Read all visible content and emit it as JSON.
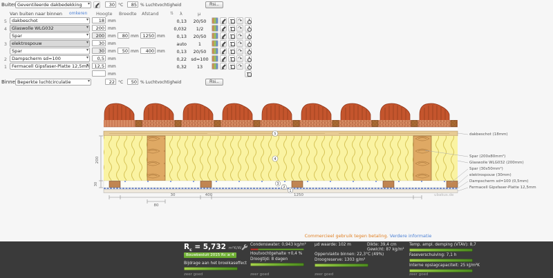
{
  "outside": {
    "label": "Buiten",
    "material": "Geventileerde dakbedekking",
    "temp": "30",
    "temp_unit": "°C",
    "humidity": "85",
    "humidity_label": "% Luchtvochtigheid",
    "rsi": "Rsi..."
  },
  "table": {
    "direction_label": "Van buiten naar binnen",
    "reverse_link": "omkeren",
    "col_hoogte": "Hoogte",
    "col_breedte": "Breedte",
    "col_afstand": "Afstand",
    "col_lambda": "λ",
    "col_mu": "µ",
    "unit_mm": "mm",
    "sort_glyph": "⇅",
    "caret_glyph": "▾",
    "move_glyph": "↷"
  },
  "layers": [
    {
      "num": "5",
      "material": "dakbeschot",
      "hoogte": "18",
      "lambda": "0,13",
      "mu": "20/50"
    },
    {
      "num": "4",
      "material": "Glaswolle WLG032",
      "hoogte": "200",
      "lambda": "0,032",
      "mu": "1/2"
    },
    {
      "num": "",
      "material": "Spar",
      "hoogte": "200",
      "breedte": "80",
      "afstand": "1250",
      "lambda": "0,13",
      "mu": "20/50"
    },
    {
      "num": "3",
      "material": "elektrospouw",
      "hoogte": "30",
      "lambda": "auto",
      "mu": "1"
    },
    {
      "num": "",
      "material": "Spar",
      "hoogte": "30",
      "breedte": "50",
      "afstand": "400",
      "lambda": "0,13",
      "mu": "20/50"
    },
    {
      "num": "2",
      "material": "Dampscherm sd=100",
      "hoogte": "0,5",
      "lambda": "0,22",
      "mu": "sd=100"
    },
    {
      "num": "1",
      "material": "Fermacell Gipsfaser-Platte 12,5mm",
      "hoogte": "12,5",
      "lambda": "0,32",
      "mu": "13"
    }
  ],
  "inside": {
    "label": "Binnen",
    "material": "Beperkte luchtcirculatie",
    "temp": "22",
    "temp_unit": "°C",
    "humidity": "50",
    "humidity_label": "% Luchtvochtigheid",
    "rsi": "Rsi..."
  },
  "diagram": {
    "labels": [
      "dakbeschot (18mm)",
      "Spar (200x80mm²)",
      "Glaswolle WLG032 (200mm)",
      "Spar (30x50mm²)",
      "elektrospouw (30mm)",
      "Dampscherm sd=100 (0,5mm)",
      "Fermacell Gipsfaser-Platte 12,5mm"
    ],
    "markers": [
      "1",
      "2",
      "3",
      "4",
      "5"
    ],
    "dim_height": "200",
    "dim_cavity": "30",
    "dim_rafter_width": "80",
    "dim_batten_width": "30",
    "dim_batten_spacing": "400",
    "dim_rafter_spacing": "1250",
    "watermark": "ubakus.de"
  },
  "notice": {
    "text": "Commercieel gebruik tegen betaling.",
    "link": "Verdere informatie"
  },
  "results": {
    "r_label": "R",
    "r_sub": "c",
    "r_value": "= 5,732",
    "r_unit": "m²K/W",
    "bouwbesluit": "Bouwbesluit 2015 Rc ≥ 4",
    "broeikas": "Bijdrage aan het broeikaseffect",
    "condenswater": "Condenswater: 0,943 kg/m²",
    "houtvocht": "Houtvochtgehalte +0,4 %",
    "droogtijd": "Droogtijd: 8 dagen",
    "mud": "µd waarde: 102 m",
    "dikte": "Dikte: 39,4 cm",
    "gewicht": "Gewicht: 87 kg/m²",
    "oppervlakte": "Oppervlakte binnen: 22,3°C (49%)",
    "droogreserve": "Droogreserve: 1303 g/m²",
    "tav": "Temp. ampl. demping (VTAV): 8,7",
    "fase": "Faseverschuiving: 7,1 h",
    "opslag": "Interne opslagcapaciteit: 25 kJ/m²K",
    "rating": "zeer goed"
  },
  "icons": {
    "edit": "pencil",
    "delete": "trash",
    "move": "rotate-arrow",
    "toggle": "power",
    "swatch": "texture-swatch",
    "sort": "sort-arrows",
    "caret": "chevron-down",
    "tools": "wrench"
  },
  "colors": {
    "accent_green": "#6cab2e",
    "bar_red": "#cc3b2e",
    "tile": "#c4552d",
    "wood": "#dfa964",
    "insulation": "#faf3a2",
    "results_bg": "#3a3a3a"
  }
}
